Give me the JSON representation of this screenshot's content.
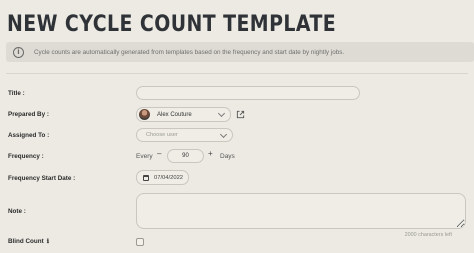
{
  "page": {
    "title": "NEW CYCLE COUNT TEMPLATE"
  },
  "info": {
    "icon": "info-icon",
    "text": "Cycle counts are automatically generated from templates based on the frequency and start date by nightly jobs."
  },
  "form": {
    "title_label": "Title :",
    "title_value": "",
    "prepared_label": "Prepared By :",
    "prepared_value": "Alex Couture",
    "assigned_label": "Assigned To :",
    "assigned_placeholder": "Choose user",
    "frequency_label": "Frequency :",
    "frequency_every": "Every",
    "frequency_minus": "–",
    "frequency_value": "90",
    "frequency_plus": "+",
    "frequency_unit": "Days",
    "start_label": "Frequency Start Date :",
    "start_value": "07/04/2022",
    "note_label": "Note :",
    "note_value": "",
    "note_counter": "2000 characters left",
    "blind_label": "Blind Count",
    "blind_checked": false
  }
}
